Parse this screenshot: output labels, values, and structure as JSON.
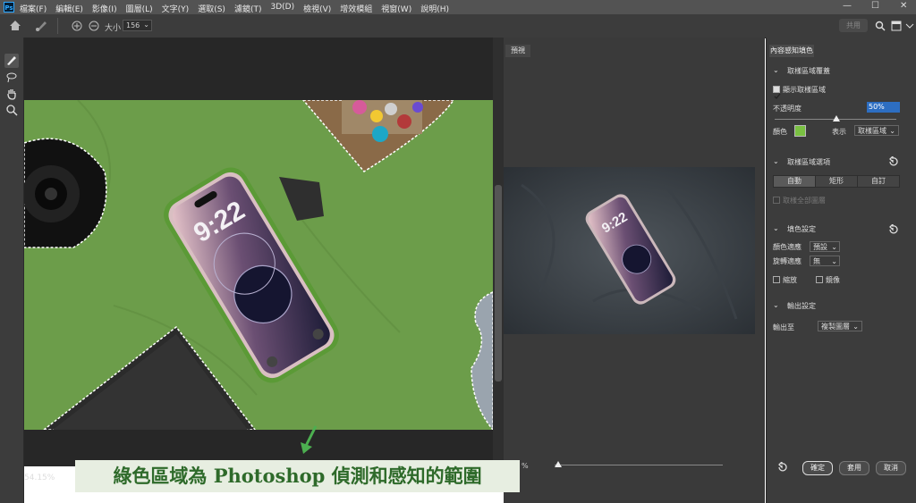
{
  "menubar": {
    "items": [
      "檔案(F)",
      "編輯(E)",
      "影像(I)",
      "圖層(L)",
      "文字(Y)",
      "選取(S)",
      "濾鏡(T)",
      "3D(D)",
      "檢視(V)",
      "增效模組",
      "視窗(W)",
      "說明(H)"
    ],
    "minimize": "—",
    "maximize": "☐",
    "close": "✕"
  },
  "optbar": {
    "size_label": "大小",
    "size_value": "156",
    "share_button": "共用"
  },
  "canvas": {
    "zoom": "54.15%",
    "phone_time": "9:22"
  },
  "preview": {
    "tab": "預視",
    "phone_time": "9:22",
    "zoom": "%"
  },
  "panel": {
    "tab": "內容感知填色",
    "sampling_overlay": "取樣區域覆蓋",
    "show_sampling": "顯示取樣區域",
    "opacity_label": "不透明度",
    "opacity_value": "50%",
    "color_label": "顏色",
    "indicate_label": "表示",
    "indicate_value": "取樣區域",
    "sampling_options": "取樣區域選項",
    "auto": "自動",
    "rectangle": "矩形",
    "custom": "自訂",
    "sample_all_layers": "取樣全部圖層",
    "fill_settings": "填色設定",
    "color_adaptation": "顏色適應",
    "color_adaptation_value": "預設",
    "rotation_adaptation": "旋轉適應",
    "rotation_adaptation_value": "無",
    "scale": "縮放",
    "mirror": "鏡像",
    "output_settings": "輸出設定",
    "output_to": "輸出至",
    "output_value": "複製圖層",
    "ok": "確定",
    "apply": "套用",
    "cancel": "取消"
  },
  "caption": "綠色區域為 Photoshop 偵測和感知的範圍",
  "colors": {
    "sampling_green": "#6c9d4a",
    "swatch": "#7ac142",
    "caption_text": "#2e6a2a"
  }
}
